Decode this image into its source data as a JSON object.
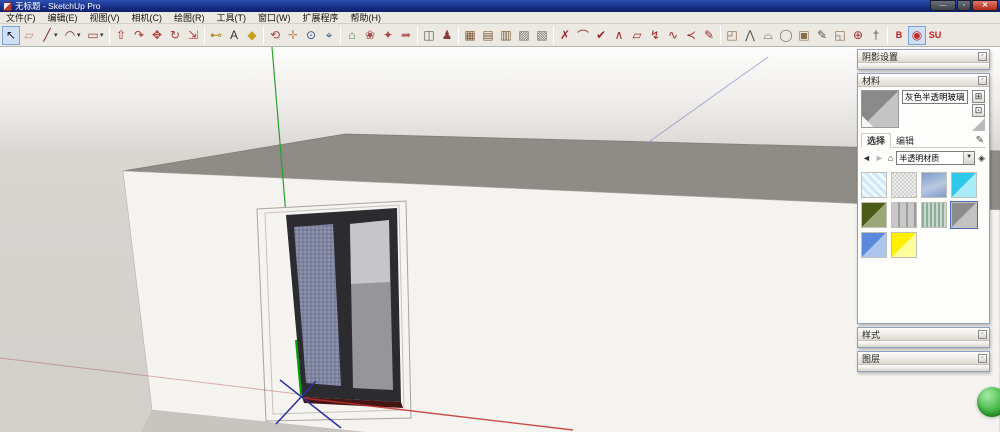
{
  "window": {
    "title": "无标题 - SketchUp Pro",
    "controls": {
      "minimize": "—",
      "maximize": "▫",
      "close": "✕"
    }
  },
  "menu": {
    "items": [
      "文件(F)",
      "编辑(E)",
      "视图(V)",
      "相机(C)",
      "绘图(R)",
      "工具(T)",
      "窗口(W)",
      "扩展程序",
      "帮助(H)"
    ]
  },
  "toolbar": {
    "groups": [
      {
        "items": [
          {
            "name": "select-tool",
            "glyph": "↖",
            "color": "#1a1a1a",
            "pressed": true
          },
          {
            "name": "eraser-tool",
            "glyph": "▱",
            "color": "#d08a94"
          },
          {
            "name": "line-tool",
            "glyph": "╱",
            "color": "#7a2020",
            "dropdown": true
          },
          {
            "name": "arc-tool",
            "glyph": "◠",
            "color": "#7a2020",
            "dropdown": true
          },
          {
            "name": "rectangle-tool",
            "glyph": "▭",
            "color": "#8a4432",
            "dropdown": true
          }
        ]
      },
      {
        "items": [
          {
            "name": "push-pull-tool",
            "glyph": "⇧",
            "color": "#a83232"
          },
          {
            "name": "follow-me-tool",
            "glyph": "↷",
            "color": "#a83232"
          },
          {
            "name": "move-tool",
            "glyph": "✥",
            "color": "#b03838"
          },
          {
            "name": "rotate-tool",
            "glyph": "↻",
            "color": "#b03838"
          },
          {
            "name": "scale-tool",
            "glyph": "⇲",
            "color": "#b03838"
          }
        ]
      },
      {
        "items": [
          {
            "name": "tape-measure-tool",
            "glyph": "⊷",
            "color": "#b08a28"
          },
          {
            "name": "text-label-tool",
            "glyph": "A",
            "color": "#333333"
          },
          {
            "name": "paint-bucket-tool",
            "glyph": "◆",
            "color": "#c8a01e"
          }
        ]
      },
      {
        "items": [
          {
            "name": "orbit-tool",
            "glyph": "⟲",
            "color": "#b04040"
          },
          {
            "name": "pan-tool",
            "glyph": "✛",
            "color": "#c09060"
          },
          {
            "name": "zoom-tool",
            "glyph": "⊙",
            "color": "#35508a"
          },
          {
            "name": "zoom-extents-tool",
            "glyph": "⌖",
            "color": "#35508a"
          }
        ]
      },
      {
        "items": [
          {
            "name": "model-library",
            "glyph": "⌂",
            "color": "#4a7a46"
          },
          {
            "name": "components-browser",
            "glyph": "❀",
            "color": "#a84848"
          },
          {
            "name": "styles-browser",
            "glyph": "✦",
            "color": "#a84848"
          },
          {
            "name": "share-model",
            "glyph": "➦",
            "color": "#b86060"
          }
        ]
      },
      {
        "items": [
          {
            "name": "section-plane-tool",
            "glyph": "◫",
            "color": "#555555"
          },
          {
            "name": "position-camera-tool",
            "glyph": "♟",
            "color": "#8a3a3a"
          }
        ]
      },
      {
        "items": [
          {
            "name": "fence-tool-1",
            "glyph": "▦",
            "color": "#7a5a38"
          },
          {
            "name": "fence-tool-2",
            "glyph": "▤",
            "color": "#7a5a38"
          },
          {
            "name": "fence-tool-3",
            "glyph": "▥",
            "color": "#7a5a38"
          },
          {
            "name": "layer-stack-1",
            "glyph": "▨",
            "color": "#6a6a6a"
          },
          {
            "name": "layer-stack-2",
            "glyph": "▧",
            "color": "#6a6a6a"
          }
        ]
      },
      {
        "items": [
          {
            "name": "curve-tool-1",
            "glyph": "✗",
            "color": "#9a2828"
          },
          {
            "name": "curve-tool-2",
            "glyph": "⌒",
            "color": "#9a2828"
          },
          {
            "name": "curve-tool-3",
            "glyph": "✔",
            "color": "#9a2828"
          },
          {
            "name": "curve-tool-4",
            "glyph": "∧",
            "color": "#9a2828"
          },
          {
            "name": "polygon-tool",
            "glyph": "▱",
            "color": "#9a2828"
          },
          {
            "name": "zigzag-tool",
            "glyph": "↯",
            "color": "#9a2828"
          },
          {
            "name": "freehand-curve-tool",
            "glyph": "∿",
            "color": "#9a2828"
          },
          {
            "name": "spline-tool",
            "glyph": "≺",
            "color": "#9a2828"
          },
          {
            "name": "sketch-pencil-tool",
            "glyph": "✎",
            "color": "#9a2828"
          }
        ]
      },
      {
        "items": [
          {
            "name": "outer-shell-tool",
            "glyph": "◰",
            "color": "#8a6a4a"
          },
          {
            "name": "intersect-tool",
            "glyph": "⋀",
            "color": "#555555"
          },
          {
            "name": "dome-tool",
            "glyph": "⌓",
            "color": "#555555"
          },
          {
            "name": "sphere-tool",
            "glyph": "◯",
            "color": "#777777"
          },
          {
            "name": "union-tool",
            "glyph": "▣",
            "color": "#8a6a4a"
          },
          {
            "name": "edit-solid-tool",
            "glyph": "✎",
            "color": "#555555"
          },
          {
            "name": "subtract-tool",
            "glyph": "◱",
            "color": "#8a6a4a"
          },
          {
            "name": "axes-tool",
            "glyph": "⊕",
            "color": "#a03030"
          },
          {
            "name": "knife-tool",
            "glyph": "†",
            "color": "#555555"
          }
        ]
      },
      {
        "items": [
          {
            "name": "plugin-b-button",
            "glyph": "B",
            "color": "#b02020",
            "text": true
          },
          {
            "name": "plugin-swirl-button",
            "glyph": "◉",
            "color": "#c03030",
            "pressed": true
          },
          {
            "name": "sketchup-pro-badge",
            "glyph": "SU",
            "color": "#c02020",
            "text": true
          }
        ]
      }
    ]
  },
  "panels": {
    "shadow_settings": {
      "title": "阴影设置",
      "rollup": "▫"
    },
    "materials": {
      "title": "材料",
      "rollup": "▫",
      "material_name": "灰色半透明玻璃",
      "create_button": "⊞",
      "default_button": "⊡",
      "eyedropper": "✎",
      "tabs": [
        {
          "label": "选择",
          "active": true
        },
        {
          "label": "编辑",
          "active": false
        }
      ],
      "nav": {
        "back": "◄",
        "forward": "►",
        "home": "⌂",
        "details": "◈",
        "caret": "▼"
      },
      "collection": "半透明材质",
      "swatches": [
        {
          "name": "translucent-checker-blue",
          "pattern": "checker",
          "c1": "#cfe9f6",
          "c2": "#f2fafd"
        },
        {
          "name": "translucent-frosted-white",
          "pattern": "noise",
          "c1": "#ececec",
          "c2": "#d2d2d2"
        },
        {
          "name": "translucent-water-blue",
          "pattern": "water",
          "c1": "#7f9cc6",
          "c2": "#b9c8e0"
        },
        {
          "name": "translucent-cyan",
          "pattern": "diagonal",
          "c1": "#2ec8ea",
          "c2": "#a8ecf8"
        },
        {
          "name": "translucent-olive-green",
          "pattern": "diagonal",
          "c1": "#4c5c18",
          "c2": "#9aa878"
        },
        {
          "name": "translucent-gray-blocks",
          "pattern": "blocks",
          "c1": "#9a9a9a",
          "c2": "#c8c8c8"
        },
        {
          "name": "translucent-green-stripes",
          "pattern": "stripes",
          "c1": "#8fae9a",
          "c2": "#c9d8cf"
        },
        {
          "name": "translucent-gray-glass",
          "pattern": "diagonal",
          "c1": "#8c8c8c",
          "c2": "#c2c2c2",
          "selected": true
        },
        {
          "name": "translucent-blue",
          "pattern": "diagonal",
          "c1": "#5b8add",
          "c2": "#adc6ee"
        },
        {
          "name": "translucent-yellow",
          "pattern": "diagonal",
          "c1": "#ffee00",
          "c2": "#ffff9a"
        }
      ]
    },
    "styles": {
      "title": "样式",
      "rollup": "▫"
    },
    "layers": {
      "title": "图层",
      "rollup": "▫"
    }
  },
  "scene": {
    "colors": {
      "background": "#d5d2ce",
      "roof": "#8f8c87",
      "wall": "#f5f3ef",
      "ground": "#c8c5c1",
      "recess": "#f6f4f0",
      "frame": "#2c2c30",
      "glass_left": "#7e84a0",
      "glass_right": "#96969a",
      "glass_right_top": "#c6c6c8",
      "sill": "#451414",
      "axis_red": "#c03030",
      "axis_red_faint": "#b25555",
      "axis_green": "#00a400",
      "axis_green_line": "#2e9e2e",
      "axis_blue": "#2a2fa0",
      "axis_blue_faint": "#8888c0"
    }
  }
}
